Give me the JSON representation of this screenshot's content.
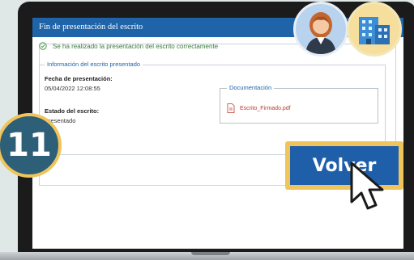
{
  "dialog": {
    "title": "Fin de presentación del escrito",
    "success_message": "Se ha realizado la presentación del escrito correctamente"
  },
  "info": {
    "legend": "Información del escrito presentado",
    "date_label": "Fecha de presentación:",
    "date_value": "05/04/2022 12:08:55",
    "status_label": "Estado del escrito:",
    "status_value": "Presentado"
  },
  "documentation": {
    "legend": "Documentación",
    "file_name": "Escrito_Firmado.pdf"
  },
  "step_badge": "11",
  "volver_button": "Volver",
  "icons": {
    "success": "check-circle-icon",
    "file": "pdf-file-icon",
    "person": "person-avatar-icon",
    "building": "building-icon",
    "cursor": "mouse-pointer-icon"
  },
  "colors": {
    "header_blue": "#1f63a8",
    "success_green": "#3a7a3a",
    "badge_teal": "#2d5f78",
    "highlight_yellow": "#f0c45a",
    "button_blue": "#1f5faa",
    "pdf_red": "#c0392b"
  }
}
